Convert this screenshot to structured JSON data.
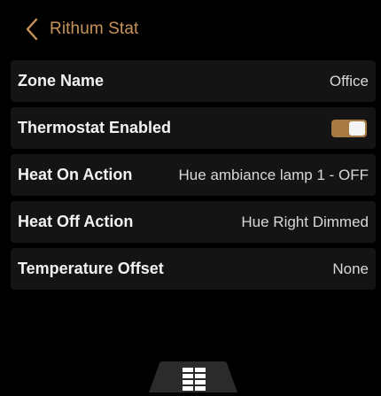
{
  "header": {
    "title": "Rithum Stat",
    "back_icon": "chevron-left-icon",
    "accent_color": "#c8935a"
  },
  "rows": [
    {
      "label": "Zone Name",
      "value": "Office"
    },
    {
      "label": "Thermostat Enabled",
      "toggle": {
        "on": true,
        "color": "#a77a44"
      }
    },
    {
      "label": "Heat On Action",
      "value": "Hue ambiance lamp 1 - OFF"
    },
    {
      "label": "Heat Off Action",
      "value": "Hue Right Dimmed"
    },
    {
      "label": "Temperature Offset",
      "value": "None"
    }
  ],
  "bottom_nav": {
    "icon": "grid-menu-icon"
  }
}
